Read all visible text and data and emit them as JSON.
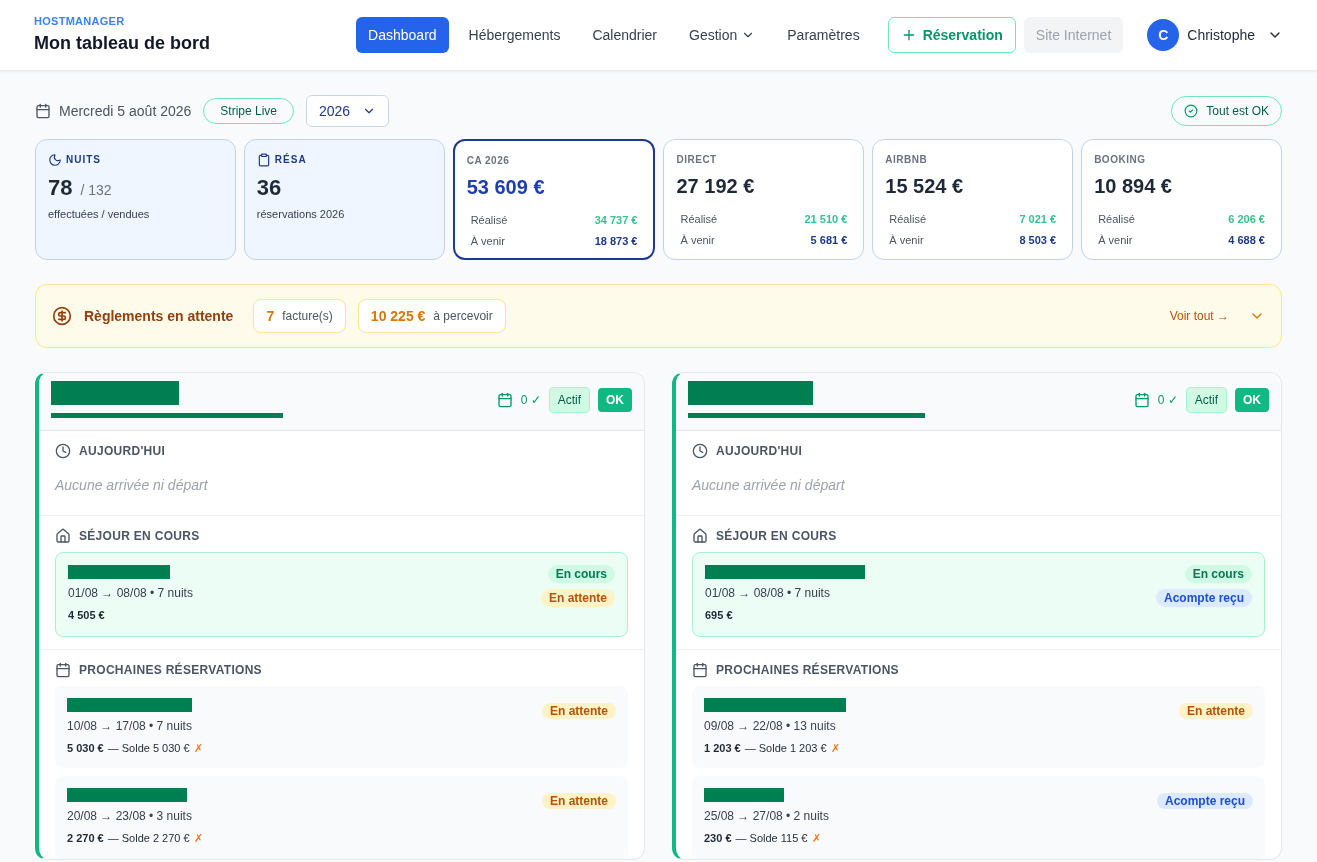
{
  "header": {
    "brand": "HOSTMANAGER",
    "title": "Mon tableau de bord",
    "nav": [
      {
        "label": "Dashboard",
        "selected": true,
        "caret": false
      },
      {
        "label": "Hébergements",
        "selected": false,
        "caret": false
      },
      {
        "label": "Calendrier",
        "selected": false,
        "caret": false
      },
      {
        "label": "Gestion",
        "selected": false,
        "caret": true
      },
      {
        "label": "Paramètres",
        "selected": false,
        "caret": false
      }
    ],
    "new_button": "Réservation",
    "site_button": {
      "label": "Site Internet",
      "disabled": true
    },
    "user": {
      "initial": "C",
      "name": "Christophe"
    }
  },
  "toolbar": {
    "date": "Mercredi 5 août 2026",
    "stripe": "Stripe Live",
    "year": "2026",
    "status": "Tout est OK"
  },
  "stats": [
    {
      "kind": "count",
      "label": "NUITS",
      "value": "78",
      "suffix": "/ 132",
      "caption": "effectuées / vendues"
    },
    {
      "kind": "count",
      "label": "RÉSA",
      "value": "36",
      "caption": "réservations 2026"
    },
    {
      "kind": "money",
      "highlight": true,
      "label": "CA 2026",
      "value": "53 609 €",
      "done_label": "Réalisé",
      "done": "34 737 €",
      "todo_label": "À venir",
      "todo": "18 873 €"
    },
    {
      "kind": "money",
      "highlight": false,
      "label": "DIRECT",
      "value": "27 192 €",
      "done_label": "Réalisé",
      "done": "21 510 €",
      "todo_label": "À venir",
      "todo": "5 681 €"
    },
    {
      "kind": "money",
      "highlight": false,
      "label": "AIRBNB",
      "value": "15 524 €",
      "done_label": "Réalisé",
      "done": "7 021 €",
      "todo_label": "À venir",
      "todo": "8 503 €"
    },
    {
      "kind": "money",
      "highlight": false,
      "label": "BOOKING",
      "value": "10 894 €",
      "done_label": "Réalisé",
      "done": "6 206 €",
      "todo_label": "À venir",
      "todo": "4 688 €"
    }
  ],
  "payments": {
    "title": "Règlements en attente",
    "count": "7",
    "count_label": "facture(s)",
    "amount": "10 225 €",
    "amount_label": "à percevoir",
    "link": "Voir tout →",
    "expanded": false
  },
  "properties": [
    {
      "checks": "0 ✓",
      "status": "Actif",
      "ok": "OK",
      "today_title": "AUJOURD'HUI",
      "today_empty": "Aucune arrivée ni départ",
      "stay_title": "SÉJOUR EN COURS",
      "stay": {
        "dates": "01/08 → 08/08 • 7 nuits",
        "amount": "4 505 €",
        "badges": [
          {
            "kind": "current",
            "label": "En cours"
          },
          {
            "kind": "pending",
            "label": "En attente"
          }
        ]
      },
      "next_title": "PROCHAINES RÉSERVATIONS",
      "bookings": [
        {
          "dates": "10/08 → 17/08 • 7 nuits",
          "amount": "5 030 €",
          "balance": "— Solde 5 030 €",
          "mark": "✗",
          "badge": {
            "kind": "pending",
            "label": "En attente"
          }
        },
        {
          "dates": "20/08 → 23/08 • 3 nuits",
          "amount": "2 270 €",
          "balance": "— Solde 2 270 €",
          "mark": "✗",
          "badge": {
            "kind": "pending",
            "label": "En attente"
          }
        }
      ]
    },
    {
      "checks": "0 ✓",
      "status": "Actif",
      "ok": "OK",
      "today_title": "AUJOURD'HUI",
      "today_empty": "Aucune arrivée ni départ",
      "stay_title": "SÉJOUR EN COURS",
      "stay": {
        "dates": "01/08 → 08/08 • 7 nuits",
        "amount": "695 €",
        "badges": [
          {
            "kind": "current",
            "label": "En cours"
          },
          {
            "kind": "deposit",
            "label": "Acompte reçu"
          }
        ]
      },
      "next_title": "PROCHAINES RÉSERVATIONS",
      "bookings": [
        {
          "dates": "09/08 → 22/08 • 13 nuits",
          "amount": "1 203 €",
          "balance": "— Solde 1 203 €",
          "mark": "✗",
          "badge": {
            "kind": "pending",
            "label": "En attente"
          }
        },
        {
          "dates": "25/08 → 27/08 • 2 nuits",
          "amount": "230 €",
          "balance": "— Solde 115 €",
          "mark": "✗",
          "badge": {
            "kind": "deposit",
            "label": "Acompte reçu"
          }
        }
      ]
    }
  ]
}
